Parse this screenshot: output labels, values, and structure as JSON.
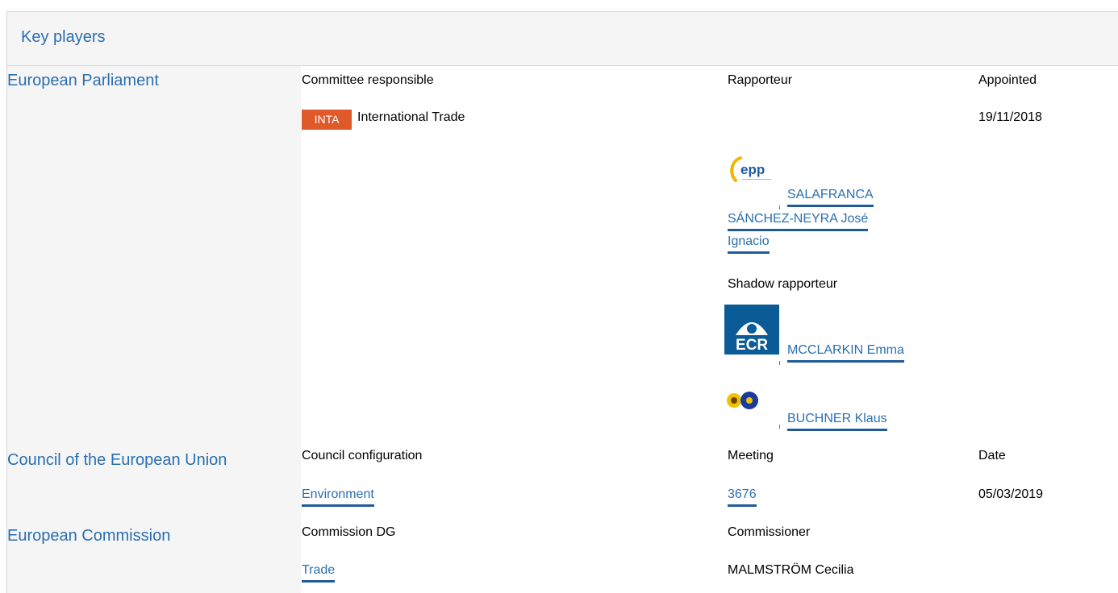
{
  "title": "Key players",
  "europeanParliament": {
    "name": "European Parliament",
    "committeeHeader": "Committee responsible",
    "rapporteurHeader": "Rapporteur",
    "appointedHeader": "Appointed",
    "committeeAbbr": "INTA",
    "committeeName": "International Trade",
    "appointedDate": "19/11/2018",
    "rapporteurLine1": "SALAFRANCA",
    "rapporteurLine2": "SÁNCHEZ-NEYRA José",
    "rapporteurLine3": "Ignacio",
    "rapporteurGroupLogo": "epp-logo",
    "shadowHeader": "Shadow rapporteur",
    "shadow1": "MCCLARKIN Emma",
    "shadow1Logo": "ecr-logo",
    "shadow1LogoText": "ECR",
    "shadow2": "BUCHNER Klaus",
    "shadow2Logo": "efa-sunflower-logo"
  },
  "council": {
    "name": "Council of the European Union",
    "configHeader": "Council configuration",
    "meetingHeader": "Meeting",
    "dateHeader": "Date",
    "config": "Environment",
    "meeting": "3676",
    "date": "05/03/2019"
  },
  "commission": {
    "name": "European Commission",
    "dgHeader": "Commission DG",
    "commissionerHeader": "Commissioner",
    "dg": "Trade",
    "commissioner": "MALMSTRÖM Cecilia"
  },
  "colors": {
    "link": "#2a6fb0",
    "badge": "#e05a29",
    "headerBg": "#f5f5f5"
  }
}
